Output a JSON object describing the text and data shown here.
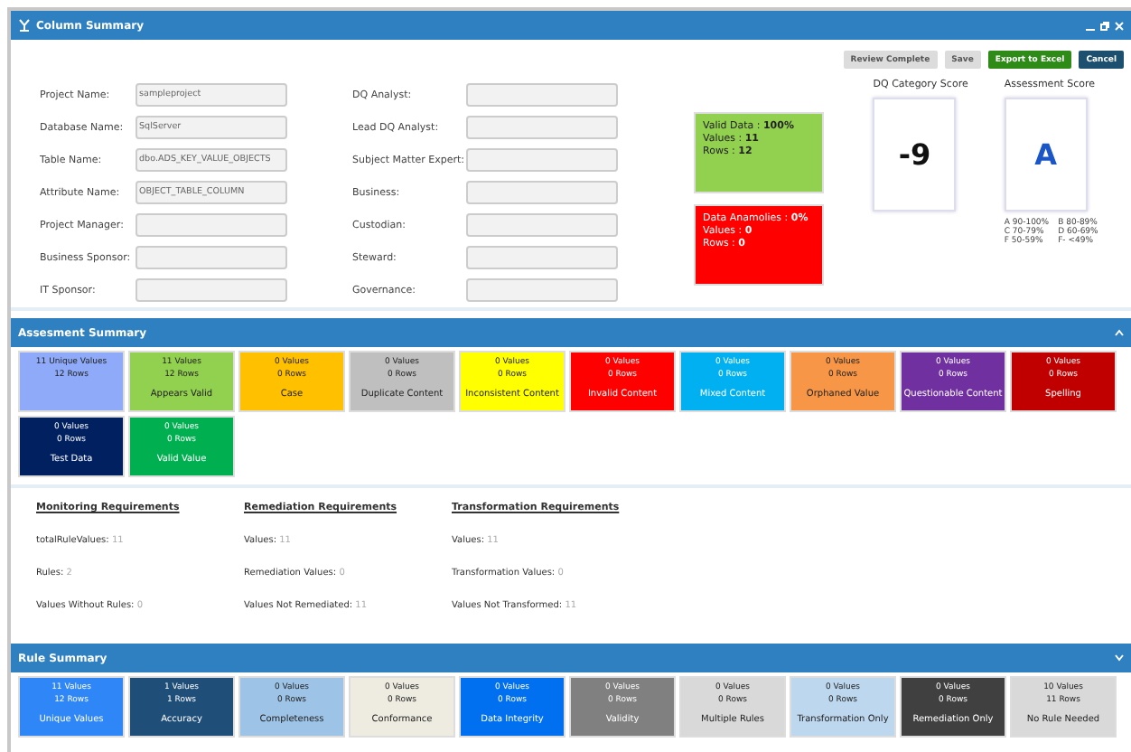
{
  "window": {
    "title": "Column Summary"
  },
  "actions": [
    {
      "label": "Review Complete",
      "kind": "disabled"
    },
    {
      "label": "Save",
      "kind": "disabled"
    },
    {
      "label": "Export to Excel",
      "kind": "primary"
    },
    {
      "label": "Cancel",
      "kind": "dark"
    }
  ],
  "fields_left": [
    {
      "label": "Project Name:",
      "value": "sampleproject"
    },
    {
      "label": "Database Name:",
      "value": "SqlServer"
    },
    {
      "label": "Table Name:",
      "value": "dbo.ADS_KEY_VALUE_OBJECTS"
    },
    {
      "label": "Attribute Name:",
      "value": "OBJECT_TABLE_COLUMN"
    },
    {
      "label": "Project Manager:"
    },
    {
      "label": "Business Sponsor:"
    },
    {
      "label": "IT Sponsor:"
    }
  ],
  "fields_right": [
    {
      "label": "DQ Analyst:"
    },
    {
      "label": "Lead DQ Analyst:"
    },
    {
      "label": "Subject Matter Expert:"
    },
    {
      "label": "Business:"
    },
    {
      "label": "Custodian:"
    },
    {
      "label": "Steward:"
    },
    {
      "label": "Governance:"
    }
  ],
  "status_boxes": [
    {
      "lines": [
        "Valid Data : **100%**",
        "Values : **11**",
        "Rows : **12**"
      ],
      "color": "#92d050"
    },
    {
      "lines": [
        "Data Anamolies : **0%**",
        "Values : **0**",
        "Rows : **0**"
      ],
      "color": "#ff0000"
    }
  ],
  "dq_category_score": {
    "title": "DQ Category Score",
    "value": "-9"
  },
  "assessment_score": {
    "title": "Assessment Score",
    "value": "A",
    "legend": [
      "A 90-100%",
      "B 80-89%",
      "C 70-79%",
      "D 60-69%",
      "F 50-59%",
      "F- <49%"
    ]
  },
  "assessment_summary": {
    "title": "Assesment Summary",
    "tiles": [
      {
        "values": "11 Unique Values",
        "rows": "12 Rows",
        "color": "#8eaaf8"
      },
      {
        "values": "11 Values",
        "rows": "12 Rows",
        "label": "Appears Valid",
        "color": "#92d050"
      },
      {
        "values": "0 Values",
        "rows": "0 Rows",
        "label": "Case",
        "color": "#ffc000"
      },
      {
        "values": "0 Values",
        "rows": "0 Rows",
        "label": "Duplicate Content",
        "color": "#bfbfbf"
      },
      {
        "values": "0 Values",
        "rows": "0 Rows",
        "label": "Inconsistent Content",
        "color": "#ffff00"
      },
      {
        "values": "0 Values",
        "rows": "0 Rows",
        "label": "Invalid Content",
        "color": "#ff0000"
      },
      {
        "values": "0 Values",
        "rows": "0 Rows",
        "label": "Mixed Content",
        "color": "#00b0f0"
      },
      {
        "values": "0 Values",
        "rows": "0 Rows",
        "label": "Orphaned Value",
        "color": "#f79646"
      },
      {
        "values": "0 Values",
        "rows": "0 Rows",
        "label": "Questionable Content",
        "color": "#7030a0"
      },
      {
        "values": "0 Values",
        "rows": "0 Rows",
        "label": "Spelling",
        "color": "#c00000"
      },
      {
        "values": "0 Values",
        "rows": "0 Rows",
        "label": "Test Data",
        "color": "#002060"
      },
      {
        "values": "0 Values",
        "rows": "0 Rows",
        "label": "Valid Value",
        "color": "#00b050"
      }
    ]
  },
  "requirements": [
    {
      "title": "Monitoring Requirements",
      "items": [
        {
          "label": "totalRuleValues:",
          "value": "11"
        },
        {
          "label": "Rules:",
          "value": "2"
        },
        {
          "label": "Values Without Rules:",
          "value": "0"
        }
      ]
    },
    {
      "title": "Remediation Requirements",
      "items": [
        {
          "label": "Values:",
          "value": "11"
        },
        {
          "label": "Remediation Values:",
          "value": "0"
        },
        {
          "label": "Values Not Remediated:",
          "value": "11"
        }
      ]
    },
    {
      "title": "Transformation Requirements",
      "items": [
        {
          "label": "Values:",
          "value": "11"
        },
        {
          "label": "Transformation Values:",
          "value": "0"
        },
        {
          "label": "Values Not Transformed:",
          "value": "11"
        }
      ]
    }
  ],
  "rule_summary": {
    "title": "Rule Summary",
    "tiles": [
      {
        "values": "11 Values",
        "rows": "12 Rows",
        "label": "Unique Values",
        "color": "#2f86f6"
      },
      {
        "values": "1 Values",
        "rows": "1 Rows",
        "label": "Accuracy",
        "color": "#1f4e79"
      },
      {
        "values": "0 Values",
        "rows": "0 Rows",
        "label": "Completeness",
        "color": "#9dc3e6"
      },
      {
        "values": "0 Values",
        "rows": "0 Rows",
        "label": "Conformance",
        "color": "#eeece1"
      },
      {
        "values": "0 Values",
        "rows": "0 Rows",
        "label": "Data Integrity",
        "color": "#0070f0"
      },
      {
        "values": "0 Values",
        "rows": "0 Rows",
        "label": "Validity",
        "color": "#808080"
      },
      {
        "values": "0 Values",
        "rows": "0 Rows",
        "label": "Multiple Rules",
        "color": "#d9d9d9"
      },
      {
        "values": "0 Values",
        "rows": "0 Rows",
        "label": "Transformation Only",
        "color": "#bdd7ee"
      },
      {
        "values": "0 Values",
        "rows": "0 Rows",
        "label": "Remediation Only",
        "color": "#404040"
      },
      {
        "values": "10 Values",
        "rows": "11 Rows",
        "label": "No Rule Needed",
        "color": "#d9d9d9"
      }
    ]
  }
}
